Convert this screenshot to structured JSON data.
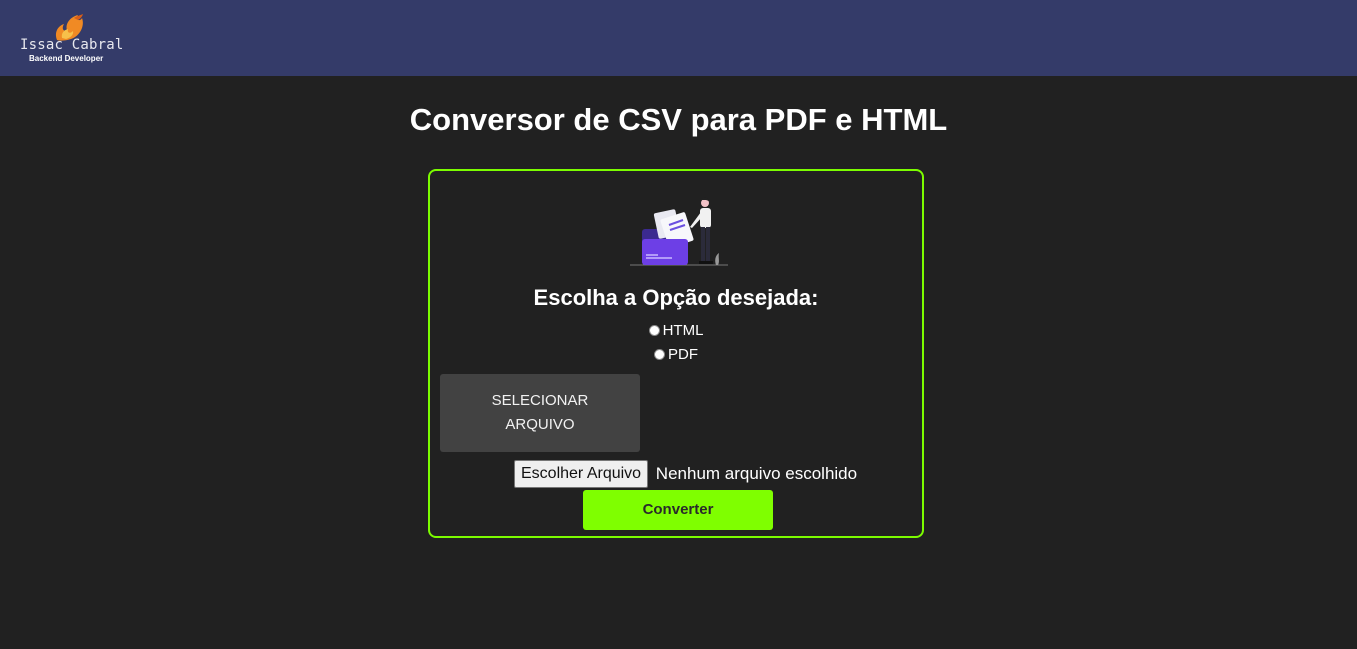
{
  "header": {
    "logo_name": "Issac Cabral",
    "logo_subtitle": "Backend Developer",
    "background_color": "#343b69",
    "logo_icon": "flame-icon"
  },
  "main": {
    "title": "Conversor de CSV para PDF e HTML"
  },
  "card": {
    "border_color": "#7cfc00",
    "illustration": "file-folder-person-illustration",
    "option_heading": "Escolha a Opção desejada:",
    "options": [
      {
        "label": "HTML",
        "checked": false
      },
      {
        "label": "PDF",
        "checked": false
      }
    ],
    "select_file_label_line1": "SELECIONAR",
    "select_file_label_line2": "ARQUIVO",
    "choose_file_label": "Escolher Arquivo",
    "no_file_text": "Nenhum arquivo escolhido",
    "convert_label": "Converter",
    "convert_color": "#7fff00"
  }
}
